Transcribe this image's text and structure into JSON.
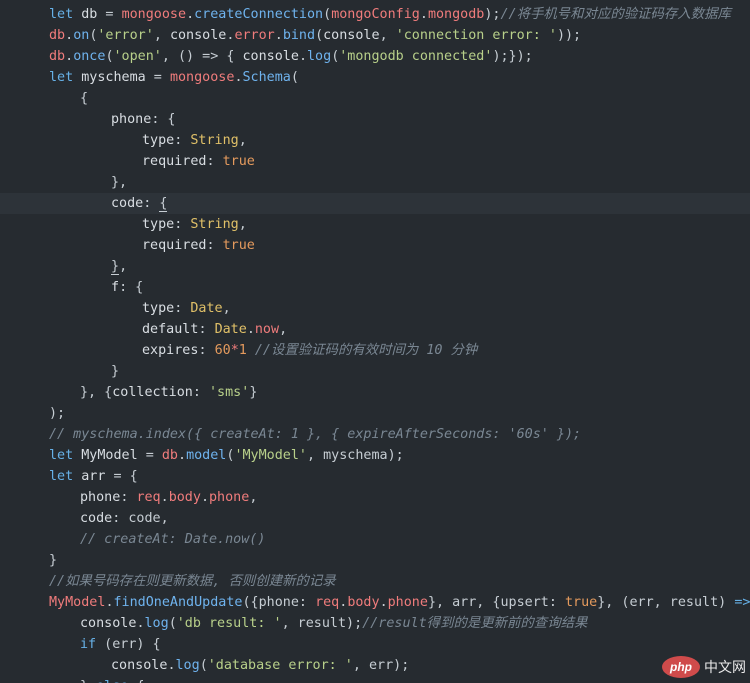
{
  "lines": [
    {
      "indent": 0,
      "highlight": false,
      "tokens": [
        {
          "t": "let ",
          "c": "kw"
        },
        {
          "t": "db",
          "c": "var"
        },
        {
          "t": " = ",
          "c": "punc"
        },
        {
          "t": "mongoose",
          "c": "obj"
        },
        {
          "t": ".",
          "c": "punc"
        },
        {
          "t": "createConnection",
          "c": "fn"
        },
        {
          "t": "(",
          "c": "punc"
        },
        {
          "t": "mongoConfig",
          "c": "obj"
        },
        {
          "t": ".",
          "c": "punc"
        },
        {
          "t": "mongodb",
          "c": "obj"
        },
        {
          "t": ");",
          "c": "punc"
        },
        {
          "t": "//将手机号和对应的验证码存入数据库",
          "c": "cmt"
        }
      ]
    },
    {
      "indent": 0,
      "highlight": false,
      "tokens": [
        {
          "t": "db",
          "c": "obj"
        },
        {
          "t": ".",
          "c": "punc"
        },
        {
          "t": "on",
          "c": "fn"
        },
        {
          "t": "(",
          "c": "punc"
        },
        {
          "t": "'error'",
          "c": "str"
        },
        {
          "t": ", ",
          "c": "punc"
        },
        {
          "t": "console",
          "c": "var"
        },
        {
          "t": ".",
          "c": "punc"
        },
        {
          "t": "error",
          "c": "obj"
        },
        {
          "t": ".",
          "c": "punc"
        },
        {
          "t": "bind",
          "c": "fn"
        },
        {
          "t": "(",
          "c": "punc"
        },
        {
          "t": "console",
          "c": "var"
        },
        {
          "t": ", ",
          "c": "punc"
        },
        {
          "t": "'connection error: '",
          "c": "str"
        },
        {
          "t": "));",
          "c": "punc"
        }
      ]
    },
    {
      "indent": 0,
      "highlight": false,
      "tokens": [
        {
          "t": "db",
          "c": "obj"
        },
        {
          "t": ".",
          "c": "punc"
        },
        {
          "t": "once",
          "c": "fn"
        },
        {
          "t": "(",
          "c": "punc"
        },
        {
          "t": "'open'",
          "c": "str"
        },
        {
          "t": ", () => { ",
          "c": "punc"
        },
        {
          "t": "console",
          "c": "var"
        },
        {
          "t": ".",
          "c": "punc"
        },
        {
          "t": "log",
          "c": "fn"
        },
        {
          "t": "(",
          "c": "punc"
        },
        {
          "t": "'mongodb connected'",
          "c": "str"
        },
        {
          "t": ");});",
          "c": "punc"
        }
      ]
    },
    {
      "indent": 0,
      "highlight": false,
      "tokens": [
        {
          "t": "let ",
          "c": "kw"
        },
        {
          "t": "myschema",
          "c": "var"
        },
        {
          "t": " = ",
          "c": "punc"
        },
        {
          "t": "mongoose",
          "c": "obj"
        },
        {
          "t": ".",
          "c": "punc"
        },
        {
          "t": "Schema",
          "c": "fn"
        },
        {
          "t": "(",
          "c": "punc"
        }
      ]
    },
    {
      "indent": 1,
      "highlight": false,
      "tokens": [
        {
          "t": "{",
          "c": "punc"
        }
      ]
    },
    {
      "indent": 2,
      "highlight": false,
      "tokens": [
        {
          "t": "phone",
          "c": "var"
        },
        {
          "t": ": {",
          "c": "punc"
        }
      ]
    },
    {
      "indent": 3,
      "highlight": false,
      "tokens": [
        {
          "t": "type",
          "c": "var"
        },
        {
          "t": ": ",
          "c": "punc"
        },
        {
          "t": "String",
          "c": "type"
        },
        {
          "t": ",",
          "c": "punc"
        }
      ]
    },
    {
      "indent": 3,
      "highlight": false,
      "tokens": [
        {
          "t": "required",
          "c": "var"
        },
        {
          "t": ": ",
          "c": "punc"
        },
        {
          "t": "true",
          "c": "bool"
        }
      ]
    },
    {
      "indent": 2,
      "highlight": false,
      "tokens": [
        {
          "t": "},",
          "c": "punc"
        }
      ]
    },
    {
      "indent": 2,
      "highlight": true,
      "tokens": [
        {
          "t": "code",
          "c": "var"
        },
        {
          "t": ": ",
          "c": "punc"
        },
        {
          "t": "{",
          "c": "cursor"
        }
      ]
    },
    {
      "indent": 3,
      "highlight": false,
      "tokens": [
        {
          "t": "type",
          "c": "var"
        },
        {
          "t": ": ",
          "c": "punc"
        },
        {
          "t": "String",
          "c": "type"
        },
        {
          "t": ",",
          "c": "punc"
        }
      ]
    },
    {
      "indent": 3,
      "highlight": false,
      "tokens": [
        {
          "t": "required",
          "c": "var"
        },
        {
          "t": ": ",
          "c": "punc"
        },
        {
          "t": "true",
          "c": "bool"
        }
      ]
    },
    {
      "indent": 2,
      "highlight": false,
      "tokens": [
        {
          "t": "}",
          "c": "cursor"
        },
        {
          "t": ",",
          "c": "punc"
        }
      ]
    },
    {
      "indent": 2,
      "highlight": false,
      "tokens": [
        {
          "t": "f",
          "c": "var"
        },
        {
          "t": ": {",
          "c": "punc"
        }
      ]
    },
    {
      "indent": 3,
      "highlight": false,
      "tokens": [
        {
          "t": "type",
          "c": "var"
        },
        {
          "t": ": ",
          "c": "punc"
        },
        {
          "t": "Date",
          "c": "type"
        },
        {
          "t": ",",
          "c": "punc"
        }
      ]
    },
    {
      "indent": 3,
      "highlight": false,
      "tokens": [
        {
          "t": "default",
          "c": "var"
        },
        {
          "t": ": ",
          "c": "punc"
        },
        {
          "t": "Date",
          "c": "type"
        },
        {
          "t": ".",
          "c": "punc"
        },
        {
          "t": "now",
          "c": "obj"
        },
        {
          "t": ",",
          "c": "punc"
        }
      ]
    },
    {
      "indent": 3,
      "highlight": false,
      "tokens": [
        {
          "t": "expires",
          "c": "var"
        },
        {
          "t": ": ",
          "c": "punc"
        },
        {
          "t": "60",
          "c": "num"
        },
        {
          "t": "*",
          "c": "obj"
        },
        {
          "t": "1",
          "c": "num"
        },
        {
          "t": " ",
          "c": "punc"
        },
        {
          "t": "//设置验证码的有效时间为 10 分钟",
          "c": "cmt"
        }
      ]
    },
    {
      "indent": 2,
      "highlight": false,
      "tokens": [
        {
          "t": "}",
          "c": "punc"
        }
      ]
    },
    {
      "indent": 1,
      "highlight": false,
      "tokens": [
        {
          "t": "}, {",
          "c": "punc"
        },
        {
          "t": "collection",
          "c": "var"
        },
        {
          "t": ": ",
          "c": "punc"
        },
        {
          "t": "'sms'",
          "c": "str"
        },
        {
          "t": "}",
          "c": "punc"
        }
      ]
    },
    {
      "indent": 0,
      "highlight": false,
      "tokens": [
        {
          "t": ");",
          "c": "punc"
        }
      ]
    },
    {
      "indent": 0,
      "highlight": false,
      "tokens": [
        {
          "t": "// myschema.index({ createAt: 1 }, { expireAfterSeconds: '60s' });",
          "c": "cmt"
        }
      ]
    },
    {
      "indent": 0,
      "highlight": false,
      "tokens": [
        {
          "t": "let ",
          "c": "kw"
        },
        {
          "t": "MyModel",
          "c": "var"
        },
        {
          "t": " = ",
          "c": "punc"
        },
        {
          "t": "db",
          "c": "obj"
        },
        {
          "t": ".",
          "c": "punc"
        },
        {
          "t": "model",
          "c": "fn"
        },
        {
          "t": "(",
          "c": "punc"
        },
        {
          "t": "'MyModel'",
          "c": "str"
        },
        {
          "t": ", myschema);",
          "c": "punc"
        }
      ]
    },
    {
      "indent": 0,
      "highlight": false,
      "tokens": [
        {
          "t": "let ",
          "c": "kw"
        },
        {
          "t": "arr",
          "c": "var"
        },
        {
          "t": " = {",
          "c": "punc"
        }
      ]
    },
    {
      "indent": 1,
      "highlight": false,
      "tokens": [
        {
          "t": "phone",
          "c": "var"
        },
        {
          "t": ": ",
          "c": "punc"
        },
        {
          "t": "req",
          "c": "obj"
        },
        {
          "t": ".",
          "c": "punc"
        },
        {
          "t": "body",
          "c": "obj"
        },
        {
          "t": ".",
          "c": "punc"
        },
        {
          "t": "phone",
          "c": "obj"
        },
        {
          "t": ",",
          "c": "punc"
        }
      ]
    },
    {
      "indent": 1,
      "highlight": false,
      "tokens": [
        {
          "t": "code",
          "c": "var"
        },
        {
          "t": ": code,",
          "c": "punc"
        }
      ]
    },
    {
      "indent": 1,
      "highlight": false,
      "tokens": [
        {
          "t": "// createAt: Date.now()",
          "c": "cmt"
        }
      ]
    },
    {
      "indent": 0,
      "highlight": false,
      "tokens": [
        {
          "t": "}",
          "c": "punc"
        }
      ]
    },
    {
      "indent": 0,
      "highlight": false,
      "tokens": [
        {
          "t": "//如果号码存在则更新数据, 否则创建新的记录",
          "c": "cmt"
        }
      ]
    },
    {
      "indent": 0,
      "highlight": false,
      "tokens": [
        {
          "t": "MyModel",
          "c": "obj"
        },
        {
          "t": ".",
          "c": "punc"
        },
        {
          "t": "findOneAndUpdate",
          "c": "fn"
        },
        {
          "t": "({phone: ",
          "c": "punc"
        },
        {
          "t": "req",
          "c": "obj"
        },
        {
          "t": ".",
          "c": "punc"
        },
        {
          "t": "body",
          "c": "obj"
        },
        {
          "t": ".",
          "c": "punc"
        },
        {
          "t": "phone",
          "c": "obj"
        },
        {
          "t": "}, arr, {upsert: ",
          "c": "punc"
        },
        {
          "t": "true",
          "c": "bool"
        },
        {
          "t": "}, (err, result) ",
          "c": "punc"
        },
        {
          "t": "=>",
          "c": "kw"
        },
        {
          "t": " {",
          "c": "punc"
        }
      ]
    },
    {
      "indent": 1,
      "highlight": false,
      "tokens": [
        {
          "t": "console",
          "c": "var"
        },
        {
          "t": ".",
          "c": "punc"
        },
        {
          "t": "log",
          "c": "fn"
        },
        {
          "t": "(",
          "c": "punc"
        },
        {
          "t": "'db result: '",
          "c": "str"
        },
        {
          "t": ", result);",
          "c": "punc"
        },
        {
          "t": "//result得到的是更新前的查询结果",
          "c": "cmt"
        }
      ]
    },
    {
      "indent": 1,
      "highlight": false,
      "tokens": [
        {
          "t": "if",
          "c": "kw"
        },
        {
          "t": " (err) {",
          "c": "punc"
        }
      ]
    },
    {
      "indent": 2,
      "highlight": false,
      "tokens": [
        {
          "t": "console",
          "c": "var"
        },
        {
          "t": ".",
          "c": "punc"
        },
        {
          "t": "log",
          "c": "fn"
        },
        {
          "t": "(",
          "c": "punc"
        },
        {
          "t": "'database error: '",
          "c": "str"
        },
        {
          "t": ", err);",
          "c": "punc"
        }
      ]
    },
    {
      "indent": 1,
      "highlight": false,
      "tokens": [
        {
          "t": "} ",
          "c": "punc"
        },
        {
          "t": "else",
          "c": "kw"
        },
        {
          "t": " {",
          "c": "punc"
        }
      ]
    }
  ],
  "watermark": {
    "logo_text": "php",
    "site_text": "中文网"
  }
}
